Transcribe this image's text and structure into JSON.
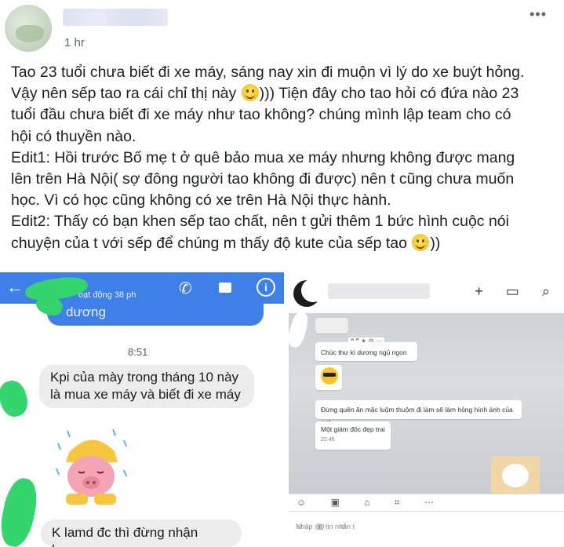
{
  "post": {
    "time": "1 hr",
    "more_label": "•••",
    "line1": "Tao 23 tuổi chưa biết đi xe máy, sáng nay xin đi muộn vì lý do xe buýt hỏng.",
    "line2a": "Vậy nên sếp tao ra cái chỉ thị này ",
    "line2b": "))) Tiện đây cho tao hỏi có đứa nào 23",
    "line3": "tuổi đầu chưa biết đi xe máy như tao không? chúng mình lập team cho có",
    "line4": "hội có thuyền nào.",
    "line5": "Edit1: Hồi trước Bố mẹ t ở quê bảo mua xe máy nhưng không được mang",
    "line6": "lên trên Hà Nội( sợ đông người tao không đi được) nên t cũng chưa muốn",
    "line7": "học. Vì có học cũng không có xe trên Hà Nội thực hành.",
    "line8": "Edit2: Thấy có bạn khen sếp tao chất, nên t gửi thêm 1 bức hình cuộc nói",
    "line9a": "chuyện của t với sếp để chúng m thấy độ kute của sếp tao ",
    "line9b": "))"
  },
  "messenger": {
    "back_icon": "←",
    "status": "oạt động 38 ph",
    "phone_icon": "✆",
    "info_icon": "i",
    "prev_message": "dương",
    "time": "8:51",
    "message1": "Kpi của mày trong tháng 10 này là mua xe máy và biết đi xe máy",
    "message2": "K lamd đc thì đừng nhận lương"
  },
  "zalo": {
    "toolbar_icons": "+ ▭ ⌕",
    "tools": "❝ ❞ ★ ⚙ ⋯",
    "message1": "Chúc thư kí dương ngủ ngon",
    "message3": "Đừng quên ăn mặc luộm thuộm đi làm sẽ làm hỏng hình ảnh của anh",
    "message4": "Một giám đốc đẹp trai",
    "message4_time": "22:45",
    "compose_tools": "☺ ▣ ⌂ ⌗ ⋯",
    "input_placeholder": "Nhập @, tin nhắn t",
    "input_icons": "☺ @ ☺"
  }
}
